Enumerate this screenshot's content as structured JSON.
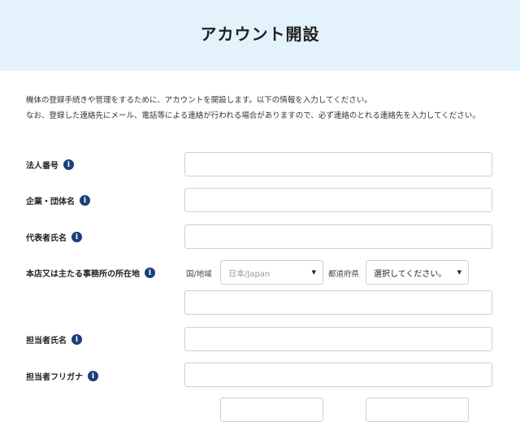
{
  "header": {
    "title": "アカウント開設"
  },
  "intro": {
    "line1": "機体の登録手続きや管理をするために、アカウントを開設します。以下の情報を入力してください。",
    "line2": "なお、登録した連絡先にメール、電話等による連絡が行われる場合がありますので、必ず連絡のとれる連絡先を入力してください。"
  },
  "form": {
    "info_glyph": "i",
    "corporate_number": {
      "label": "法人番号",
      "value": ""
    },
    "company_name": {
      "label": "企業・団体名",
      "value": ""
    },
    "representative_name": {
      "label": "代表者氏名",
      "value": ""
    },
    "head_office": {
      "label": "本店又は主たる事務所の所在地",
      "country_label": "国/地域",
      "country_value": "日本/Japan",
      "prefecture_label": "都道府県",
      "prefecture_value": "選択してください。",
      "address_value": ""
    },
    "contact_name": {
      "label": "担当者氏名",
      "value": ""
    },
    "contact_furigana": {
      "label": "担当者フリガナ",
      "value": ""
    }
  },
  "colors": {
    "header_bg": "#e4f2fb",
    "info_icon": "#1c3f78",
    "placeholder_text": "#999999"
  },
  "icons": {
    "info": "info-icon",
    "dropdown": "chevron-down-icon"
  }
}
